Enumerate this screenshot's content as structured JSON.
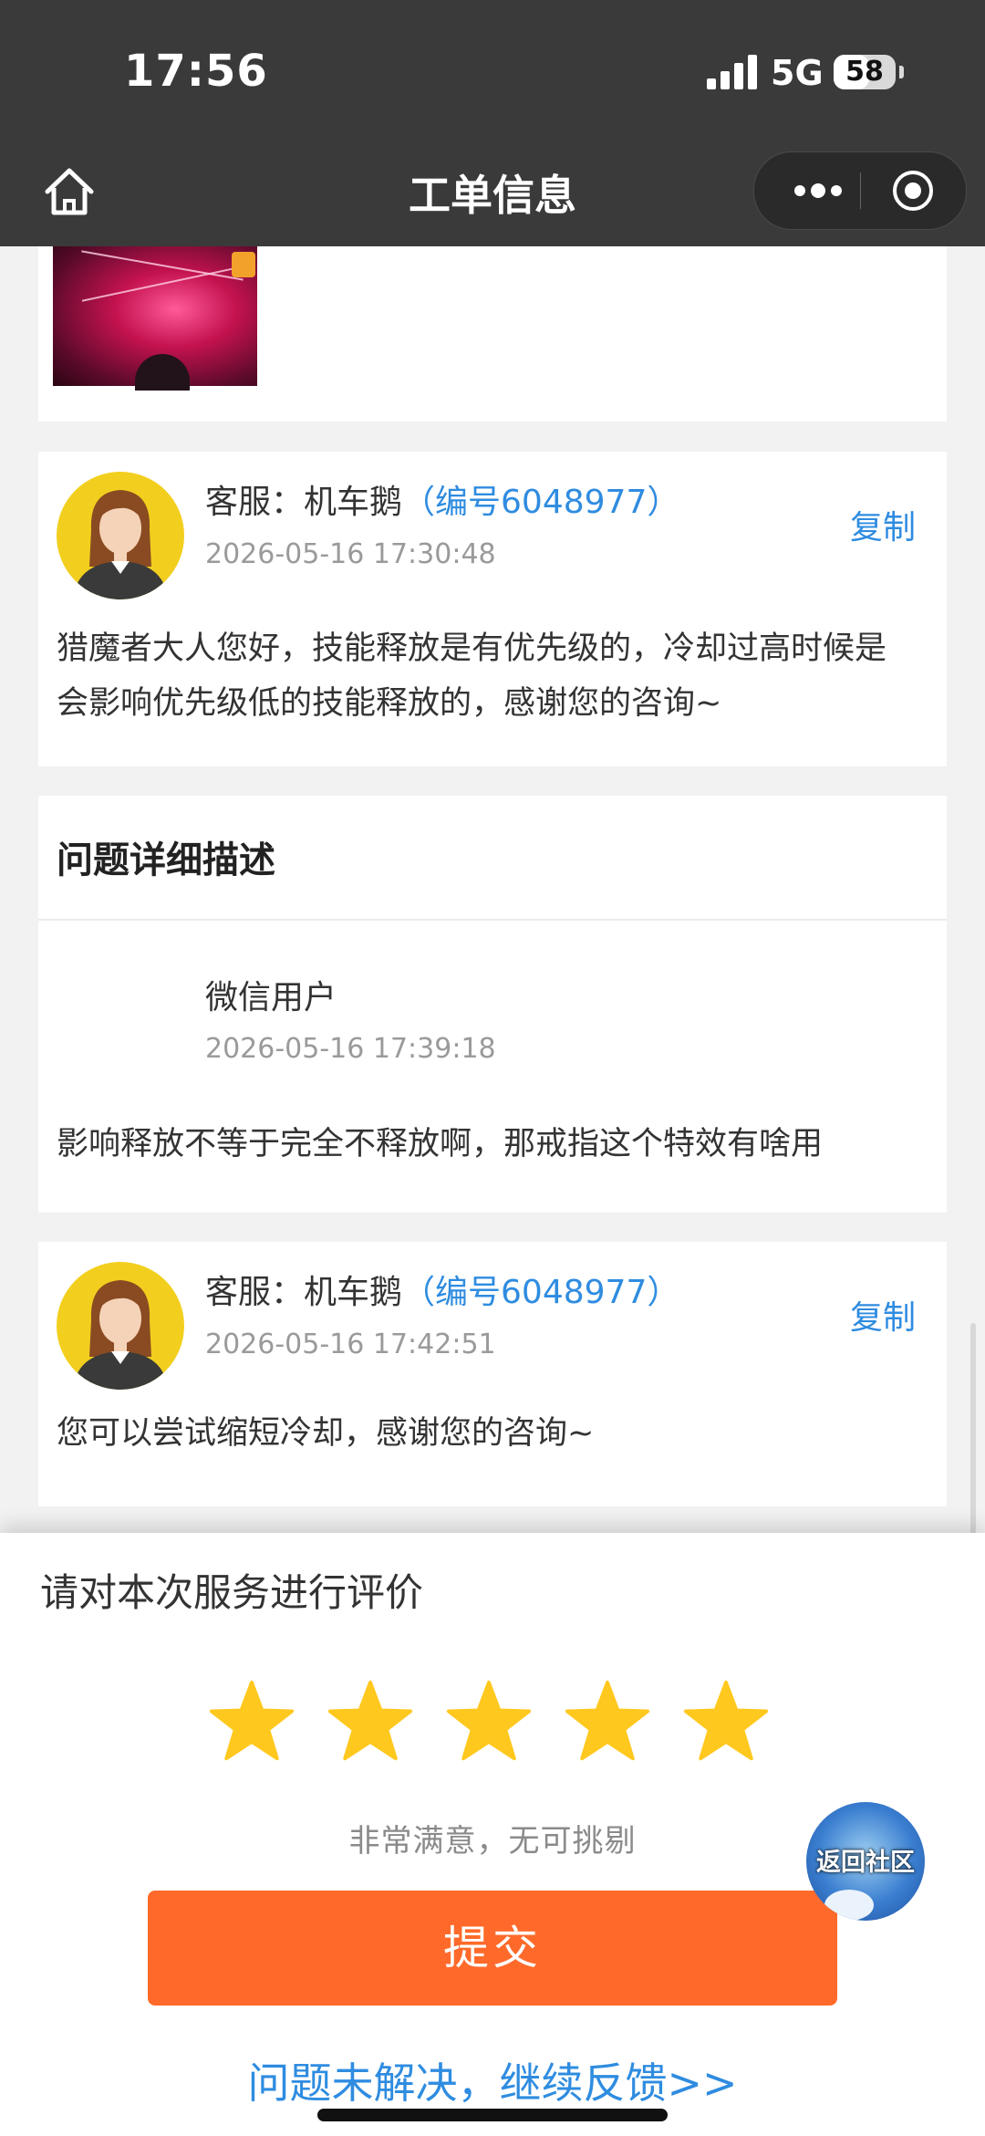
{
  "status_bar": {
    "time": "17:56",
    "network": "5G",
    "battery": "58",
    "battery_level": 0.58
  },
  "nav": {
    "title": "工单信息"
  },
  "cards": {
    "reply1": {
      "agent_prefix": "客服：机车鹅",
      "agent_id": "（编号6048977）",
      "time": "2026-05-16 17:30:48",
      "copy_label": "复制",
      "message": "猎魔者大人您好，技能释放是有优先级的，冷却过高时候是会影响优先级低的技能释放的，感谢您的咨询~"
    },
    "detail": {
      "section_title": "问题详细描述",
      "user": "微信用户",
      "time": "2026-05-16 17:39:18",
      "message": "影响释放不等于完全不释放啊，那戒指这个特效有啥用"
    },
    "reply2": {
      "agent_prefix": "客服：机车鹅",
      "agent_id": "（编号6048977）",
      "time": "2026-05-16 17:42:51",
      "copy_label": "复制",
      "message": "您可以尝试缩短冷却，感谢您的咨询~"
    }
  },
  "rating": {
    "title": "请对本次服务进行评价",
    "stars_selected": 5,
    "stars_total": 5,
    "star_color": "#ffc81e",
    "text": "非常满意，无可挑剔",
    "submit_label": "提交",
    "feedback_link": "问题未解决，继续反馈>>"
  },
  "float_button": {
    "label": "返回社区"
  },
  "colors": {
    "accent_blue": "#2f8ce0",
    "submit_orange": "#ff6a2a",
    "avatar_yellow": "#f2cf1e"
  }
}
